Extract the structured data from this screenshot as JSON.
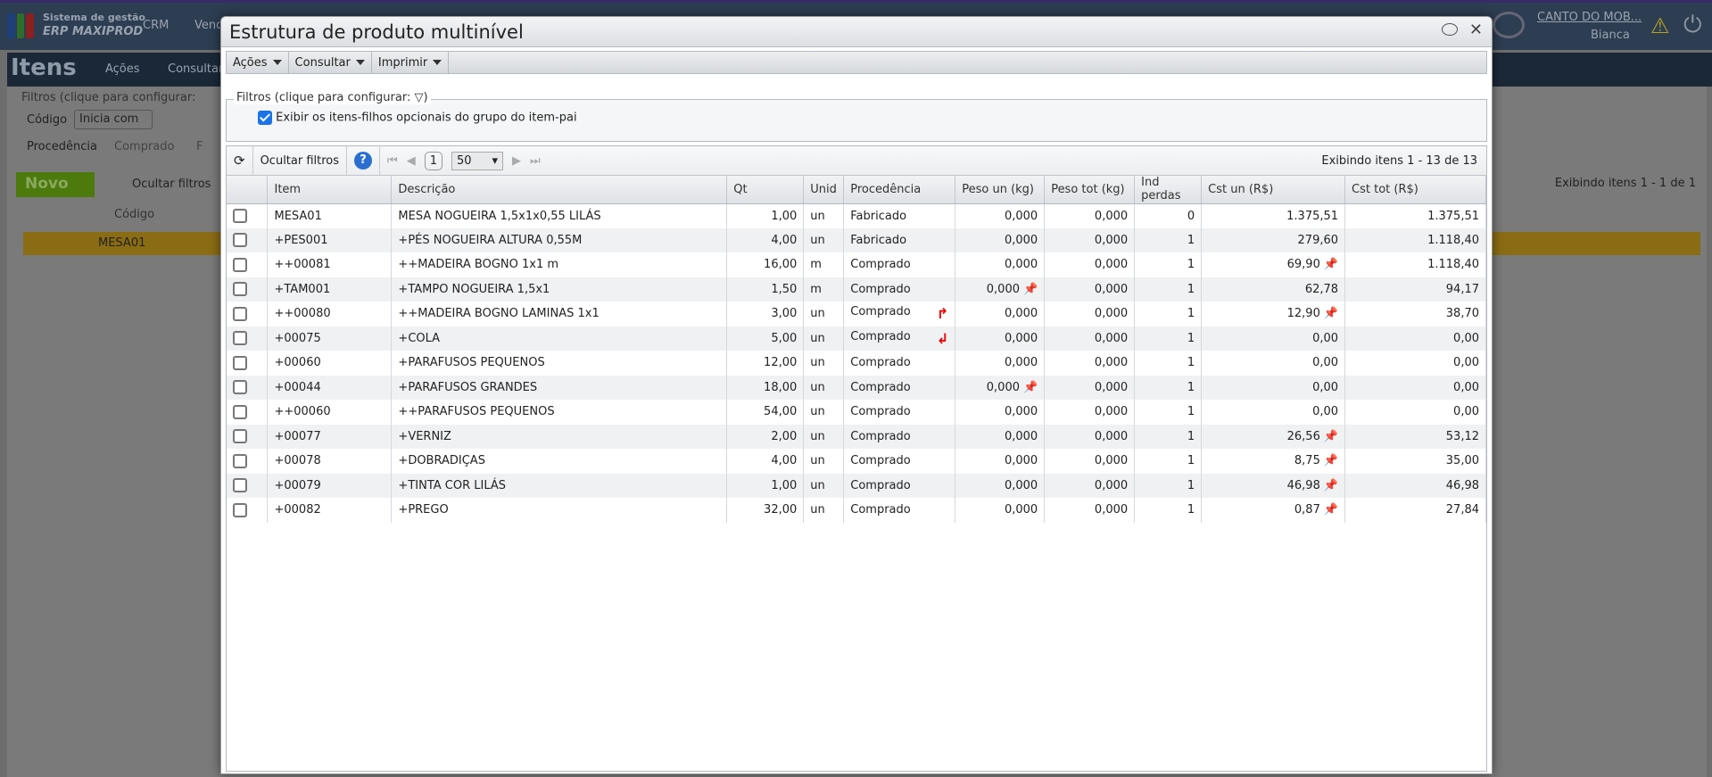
{
  "background": {
    "brand_line1": "Sistema de gestão",
    "brand_line2": "ERP MAXIPROD",
    "nav": [
      "CRM",
      "Vend"
    ],
    "company": "CANTO DO MOB...",
    "user": "Bianca",
    "page_title": "Itens",
    "page_menu": [
      "Ações",
      "Consultar"
    ],
    "filters_legend": "Filtros (clique para configurar:",
    "codigo_label": "Código",
    "codigo_select": "Inicia com",
    "procedencia_label": "Procedência",
    "procedencia_opts": [
      "Comprado",
      "F"
    ],
    "novo": "Novo",
    "ocultar": "Ocultar filtros",
    "col_codigo": "Código",
    "row_code": "MESA01",
    "status": "Exibindo itens 1 - 1 de 1"
  },
  "modal": {
    "title": "Estrutura de produto multinível",
    "menus": [
      "Ações",
      "Consultar",
      "Imprimir"
    ],
    "filters_legend": "Filtros (clique para configurar:",
    "filters_legend_end": ")",
    "opt_children": "Exibir os itens-filhos opcionais do grupo do item-pai",
    "hide_filters": "Ocultar filtros",
    "page": "1",
    "page_size": "50",
    "status": "Exibindo itens 1 - 13 de 13",
    "columns": [
      "Item",
      "Descrição",
      "Qt",
      "Unid",
      "Procedência",
      "Peso un (kg)",
      "Peso tot (kg)",
      "Ind perdas",
      "Cst un (R$)",
      "Cst tot (R$)"
    ],
    "rows": [
      {
        "item": "MESA01",
        "desc": "MESA NOGUEIRA 1,5x1x0,55 LILÁS",
        "qt": "1,00",
        "unid": "un",
        "proc": "Fabricado",
        "pu": "0,000",
        "pt": "0,000",
        "ind": "0",
        "cu": "1.375,51",
        "ct": "1.375,51"
      },
      {
        "item": "+PES001",
        "desc": "+PÉS NOGUEIRA ALTURA 0,55M",
        "qt": "4,00",
        "unid": "un",
        "proc": "Fabricado",
        "pu": "0,000",
        "pt": "0,000",
        "ind": "1",
        "cu": "279,60",
        "ct": "1.118,40"
      },
      {
        "item": "++00081",
        "desc": "++MADEIRA BOGNO 1x1 m",
        "qt": "16,00",
        "unid": "m",
        "proc": "Comprado",
        "pu": "0,000",
        "pt": "0,000",
        "ind": "1",
        "cu": "69,90",
        "ct": "1.118,40",
        "cu_pin": true
      },
      {
        "item": "+TAM001",
        "desc": "+TAMPO NOGUEIRA 1,5x1",
        "qt": "1,50",
        "unid": "m",
        "proc": "Comprado",
        "pu": "0,000",
        "pt": "0,000",
        "ind": "1",
        "cu": "62,78",
        "ct": "94,17",
        "pu_pin": true
      },
      {
        "item": "++00080",
        "desc": "++MADEIRA BOGNO LAMINAS 1x1",
        "qt": "3,00",
        "unid": "un",
        "proc": "Comprado",
        "pu": "0,000",
        "pt": "0,000",
        "ind": "1",
        "cu": "12,90",
        "ct": "38,70",
        "cu_pin": true,
        "arrow": "up"
      },
      {
        "item": "+00075",
        "desc": "+COLA",
        "qt": "5,00",
        "unid": "un",
        "proc": "Comprado",
        "pu": "0,000",
        "pt": "0,000",
        "ind": "1",
        "cu": "0,00",
        "ct": "0,00",
        "arrow": "down"
      },
      {
        "item": "+00060",
        "desc": "+PARAFUSOS PEQUENOS",
        "qt": "12,00",
        "unid": "un",
        "proc": "Comprado",
        "pu": "0,000",
        "pt": "0,000",
        "ind": "1",
        "cu": "0,00",
        "ct": "0,00"
      },
      {
        "item": "+00044",
        "desc": "+PARAFUSOS GRANDES",
        "qt": "18,00",
        "unid": "un",
        "proc": "Comprado",
        "pu": "0,000",
        "pt": "0,000",
        "ind": "1",
        "cu": "0,00",
        "ct": "0,00",
        "pu_pin": true
      },
      {
        "item": "++00060",
        "desc": "++PARAFUSOS PEQUENOS",
        "qt": "54,00",
        "unid": "un",
        "proc": "Comprado",
        "pu": "0,000",
        "pt": "0,000",
        "ind": "1",
        "cu": "0,00",
        "ct": "0,00"
      },
      {
        "item": "+00077",
        "desc": "+VERNIZ",
        "qt": "2,00",
        "unid": "un",
        "proc": "Comprado",
        "pu": "0,000",
        "pt": "0,000",
        "ind": "1",
        "cu": "26,56",
        "ct": "53,12",
        "cu_pin": true
      },
      {
        "item": "+00078",
        "desc": "+DOBRADIÇAS",
        "qt": "4,00",
        "unid": "un",
        "proc": "Comprado",
        "pu": "0,000",
        "pt": "0,000",
        "ind": "1",
        "cu": "8,75",
        "ct": "35,00",
        "cu_pin": true
      },
      {
        "item": "+00079",
        "desc": "+TINTA COR LILÁS",
        "qt": "1,00",
        "unid": "un",
        "proc": "Comprado",
        "pu": "0,000",
        "pt": "0,000",
        "ind": "1",
        "cu": "46,98",
        "ct": "46,98",
        "cu_pin": true
      },
      {
        "item": "+00082",
        "desc": "+PREGO",
        "qt": "32,00",
        "unid": "un",
        "proc": "Comprado",
        "pu": "0,000",
        "pt": "0,000",
        "ind": "1",
        "cu": "0,87",
        "ct": "27,84",
        "cu_pin": true
      }
    ]
  }
}
